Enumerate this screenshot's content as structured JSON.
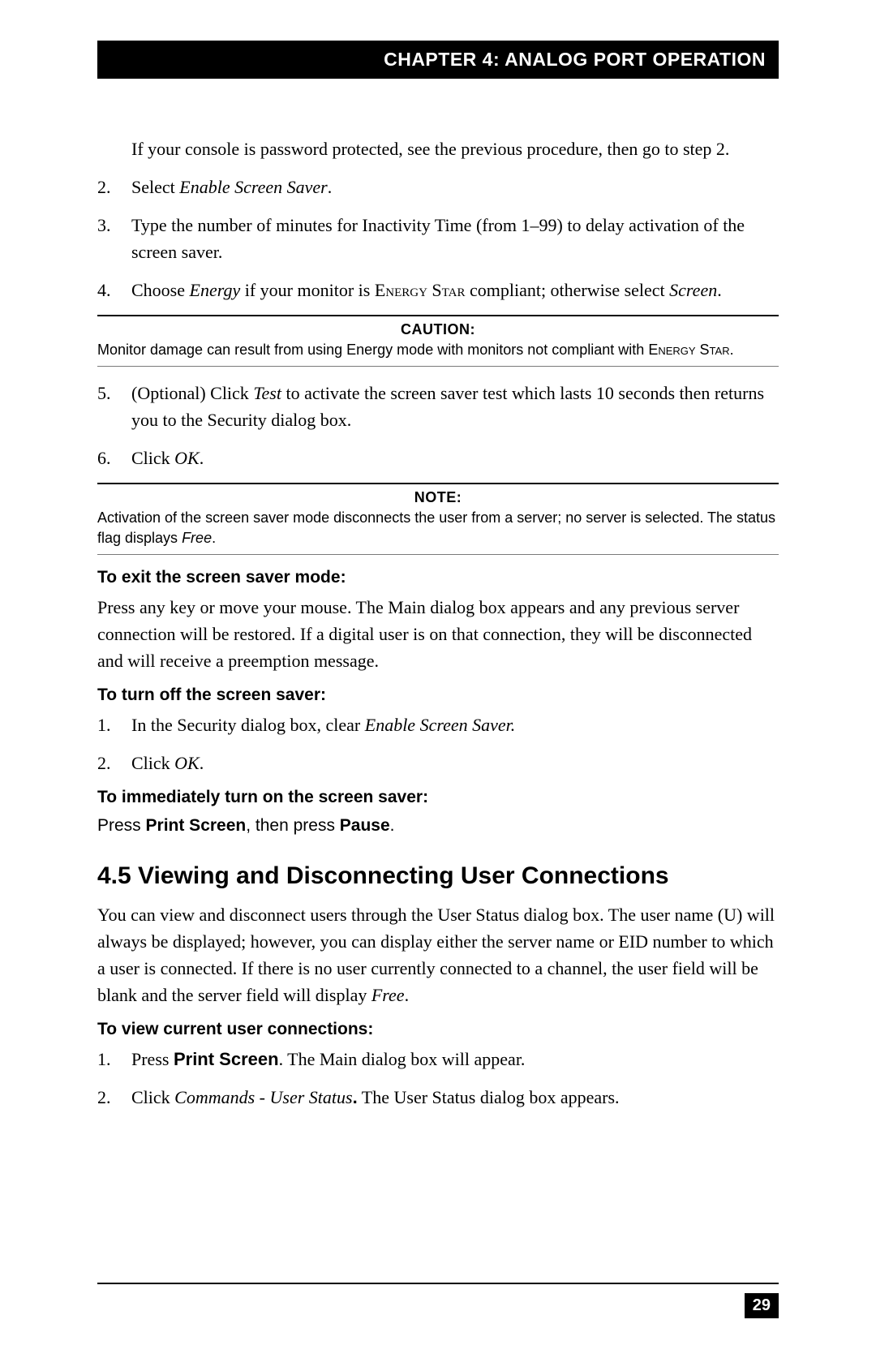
{
  "header": {
    "chapter": "CHAPTER 4: ANALOG PORT OPERATION"
  },
  "intro": {
    "line": "If your console is password protected, see the previous procedure, then go to step 2."
  },
  "steps_a": [
    {
      "n": "2.",
      "pre": "Select ",
      "em": "Enable Screen Saver",
      "post": "."
    },
    {
      "n": "3.",
      "text": "Type the number of minutes for Inactivity Time (from 1–99) to delay activation of the screen saver."
    },
    {
      "n": "4.",
      "pre": "Choose ",
      "em": "Energy",
      "mid": " if your monitor is ",
      "sc": "Energy Star",
      "mid2": " compliant; otherwise select ",
      "em2": "Screen",
      "post": "."
    }
  ],
  "caution": {
    "title": "CAUTION:",
    "pre": "Monitor damage can result from using Energy mode with monitors not compliant with ",
    "sc": "Energy Star",
    "post": "."
  },
  "steps_b": [
    {
      "n": "5.",
      "pre": "(Optional) Click ",
      "em": "Test",
      "post": " to activate the screen saver test which lasts 10 seconds then returns you to the Security dialog box."
    },
    {
      "n": "6.",
      "pre": "Click ",
      "em": "OK",
      "post": "."
    }
  ],
  "note": {
    "title": "NOTE:",
    "pre": "Activation of the screen saver mode disconnects the user from a server; no server is selected. The status flag displays ",
    "em": "Free",
    "post": "."
  },
  "exit": {
    "head": "To exit the screen saver mode:",
    "body": "Press any key or move your mouse. The Main dialog box appears and any previous server connection will be restored. If a digital user is on that connection, they will be disconnected and will receive a preemption message."
  },
  "turnoff": {
    "head": "To turn off the screen saver:",
    "steps": [
      {
        "n": "1.",
        "pre": "In the Security dialog box, clear ",
        "em": "Enable Screen Saver.",
        "post": ""
      },
      {
        "n": "2.",
        "pre": "Click ",
        "em": "OK",
        "post": "."
      }
    ]
  },
  "turnon": {
    "head": "To immediately turn on the screen saver:",
    "body_pre": "Press ",
    "b1": "Print Screen",
    "body_mid": ", then press ",
    "b2": "Pause",
    "body_post": "."
  },
  "section": {
    "title": "4.5 Viewing and Disconnecting User Connections",
    "body_pre": "You can view and disconnect users through the User Status dialog box. The user name (U) will always be displayed; however, you can display either the server name or EID number to which a user is connected. If there is no user currently connected to a channel, the user field will be blank and the server field will display ",
    "body_em": "Free",
    "body_post": "."
  },
  "viewconn": {
    "head": "To view current user connections:",
    "steps": [
      {
        "n": "1.",
        "pre": "Press ",
        "b": "Print Screen",
        "post": ". The Main dialog box will appear."
      },
      {
        "n": "2.",
        "pre": "Click ",
        "em": "Commands - User Status",
        "b": ".",
        "post": " The User Status dialog box appears."
      }
    ]
  },
  "page_number": "29"
}
